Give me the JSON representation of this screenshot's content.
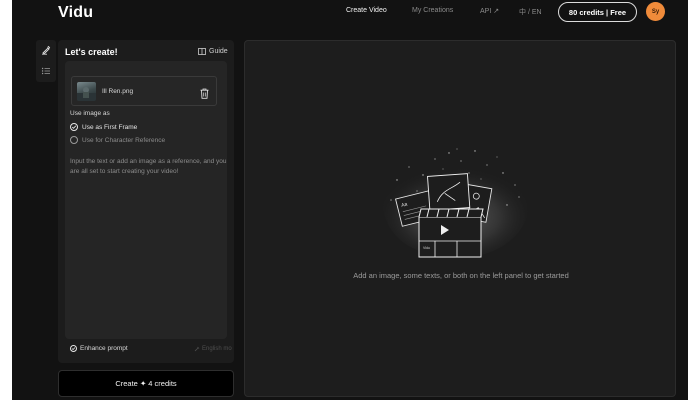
{
  "header": {
    "logo": "Vidu",
    "nav": {
      "create_video": "Create Video",
      "my_creations": "My Creations",
      "api": "API ↗",
      "language": "中 / EN"
    },
    "credits": "80 credits | Free",
    "avatar_initials": "Sy"
  },
  "panel": {
    "title": "Let's create!",
    "guide": "Guide",
    "file_name": "Ill Ren.png",
    "use_image_label": "Use image as",
    "options": [
      {
        "label": "Use as First Frame",
        "selected": true
      },
      {
        "label": "Use for Character Reference",
        "selected": false
      }
    ],
    "hint": "Input the text or add an image as a reference, and you are all set to start creating your video!",
    "enhance": "Enhance prompt",
    "english_mode": "English mo"
  },
  "create_button": "Create ✦ 4 credits",
  "main": {
    "empty_text": "Add an image, some texts, or both on the left panel to get started"
  },
  "colors": {
    "background": "#121212",
    "panel": "#1c1c1c",
    "avatar": "#f08b3a"
  },
  "icons": [
    "edit-icon",
    "list-icon",
    "book-icon",
    "trash-icon",
    "check-circle-icon",
    "radio-icon",
    "sparkle-icon"
  ]
}
